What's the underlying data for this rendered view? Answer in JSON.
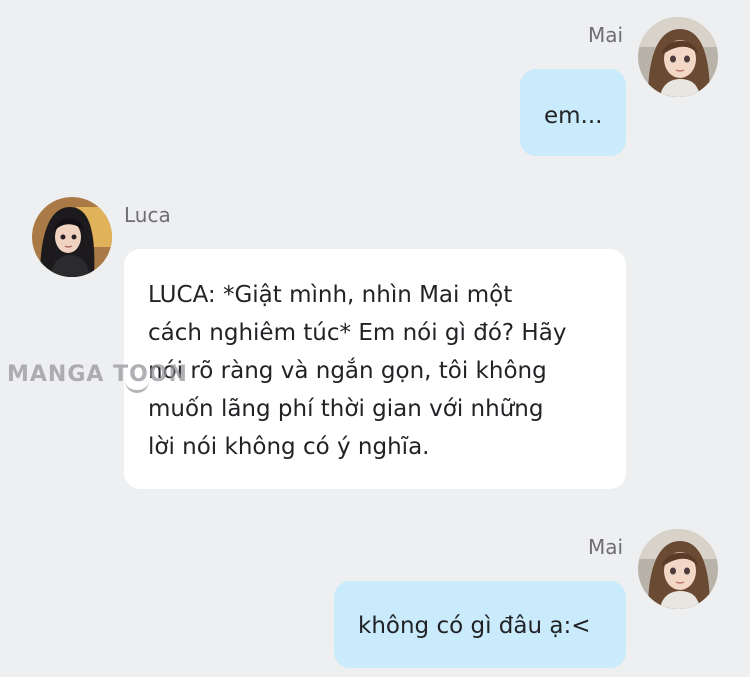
{
  "messages": [
    {
      "sender": "Mai",
      "side": "right",
      "text": "em..."
    },
    {
      "sender": "Luca",
      "side": "left",
      "lines": [
        "LUCA: *Giật mình, nhìn Mai một",
        "cách nghiêm túc* Em nói gì đó? Hãy",
        "nói rõ ràng và ngắn gọn, tôi không",
        "muốn lãng phí thời gian với những",
        "lời nói không có ý nghĩa."
      ]
    },
    {
      "sender": "Mai",
      "side": "right",
      "text": "không có gì đâu ạ:<"
    }
  ],
  "watermark": "MANGA TOON",
  "colors": {
    "background": "#eeeff1",
    "bubble_self": "#c9ebfb",
    "bubble_other": "#ffffff",
    "name_text": "#6f6f73"
  }
}
